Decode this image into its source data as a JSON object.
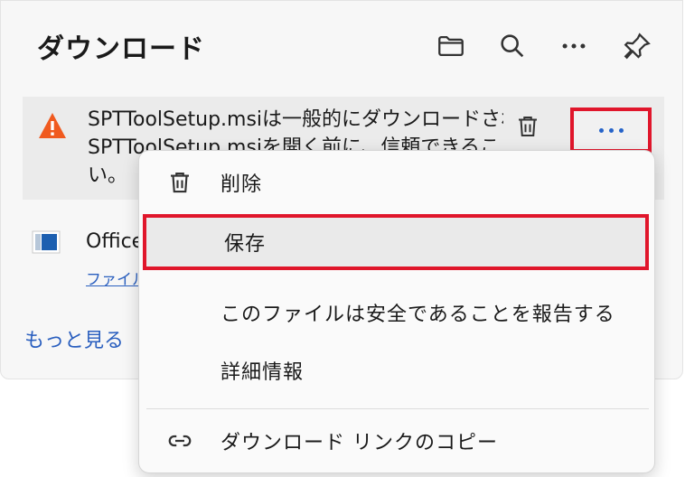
{
  "panel": {
    "title": "ダウンロード",
    "header_icons": [
      "folder-icon",
      "search-icon",
      "more-icon",
      "pin-icon"
    ]
  },
  "item1": {
    "icon": "warning-icon",
    "text_line1": "SPTToolSetup.msiは一般的にダウンロードされ",
    "text_line2": "SPTToolSetup.msiを開く前に、信頼できるこ",
    "text_line3": "い。",
    "delete_icon": "trash-icon",
    "more_icon": "more-icon"
  },
  "item2": {
    "icon": "office-icon",
    "name": "Office",
    "link": "ファイル"
  },
  "more_link": "もっと見る",
  "menu": {
    "items": [
      {
        "label": "削除",
        "icon": "trash-icon"
      },
      {
        "label": "保存",
        "icon": ""
      },
      {
        "label": "このファイルは安全であることを報告する",
        "icon": ""
      },
      {
        "label": "詳細情報",
        "icon": ""
      },
      {
        "label": "ダウンロード リンクのコピー",
        "icon": "link-icon"
      }
    ]
  },
  "colors": {
    "highlight_border": "#e0162b",
    "link": "#2a5fbf",
    "warning": "#f05a1f",
    "accent_dots": "#2563c9"
  }
}
